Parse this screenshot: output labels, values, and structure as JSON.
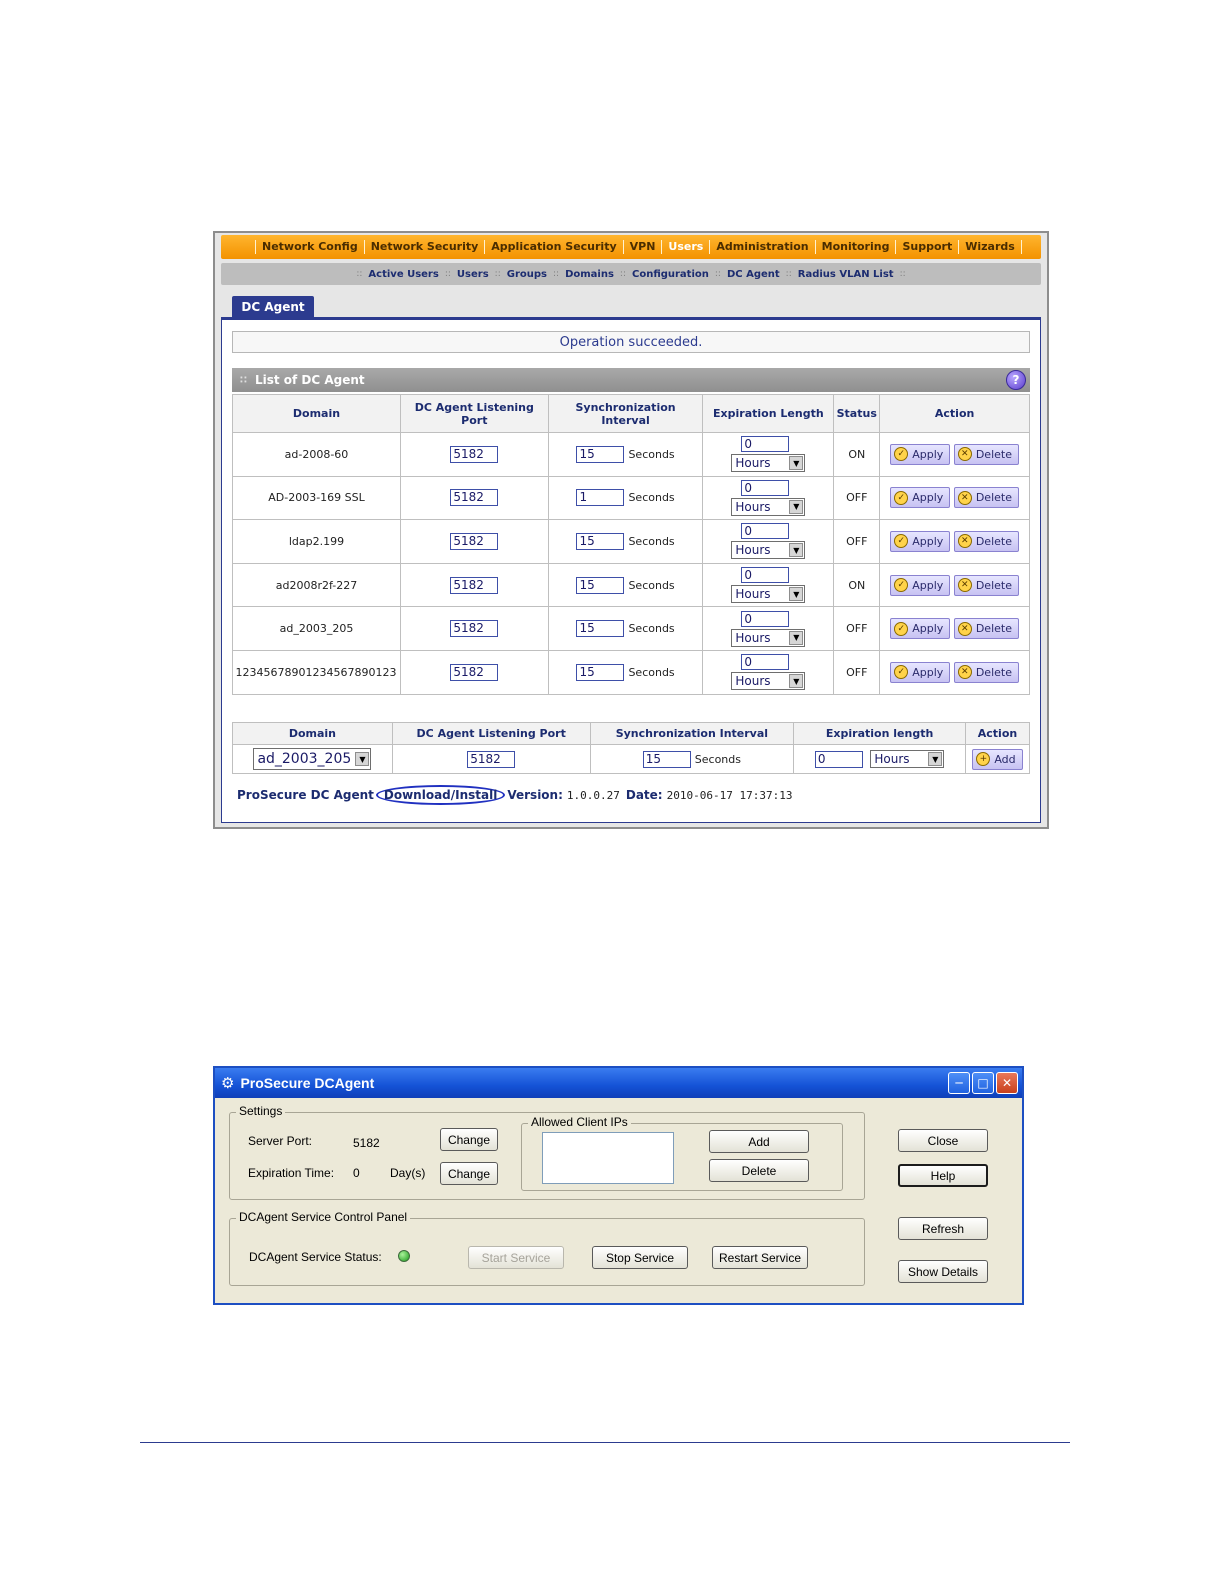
{
  "web": {
    "topnav": [
      "Network Config",
      "Network Security",
      "Application Security",
      "VPN",
      "Users",
      "Administration",
      "Monitoring",
      "Support",
      "Wizards"
    ],
    "topnav_active": "Users",
    "subnav": [
      "Active Users",
      "Users",
      "Groups",
      "Domains",
      "Configuration",
      "DC Agent",
      "Radius VLAN List"
    ],
    "subnav_sep": "::",
    "tab": "DC Agent",
    "message": "Operation succeeded.",
    "list_title": "List of DC Agent",
    "help_glyph": "?",
    "columns": {
      "domain": "Domain",
      "port": "DC Agent Listening Port",
      "sync": "Synchronization Interval",
      "exp": "Expiration Length",
      "status": "Status",
      "action": "Action"
    },
    "seconds_label": "Seconds",
    "apply_label": "Apply",
    "delete_label": "Delete",
    "rows": [
      {
        "domain": "ad-2008-60",
        "port": "5182",
        "sync": "15",
        "exp": "0",
        "unit": "Hours",
        "status": "ON"
      },
      {
        "domain": "AD-2003-169 SSL",
        "port": "5182",
        "sync": "1",
        "exp": "0",
        "unit": "Hours",
        "status": "OFF"
      },
      {
        "domain": "ldap2.199",
        "port": "5182",
        "sync": "15",
        "exp": "0",
        "unit": "Hours",
        "status": "OFF"
      },
      {
        "domain": "ad2008r2f-227",
        "port": "5182",
        "sync": "15",
        "exp": "0",
        "unit": "Hours",
        "status": "ON"
      },
      {
        "domain": "ad_2003_205",
        "port": "5182",
        "sync": "15",
        "exp": "0",
        "unit": "Hours",
        "status": "OFF"
      },
      {
        "domain": "12345678901234567890123",
        "port": "5182",
        "sync": "15",
        "exp": "0",
        "unit": "Hours",
        "status": "OFF"
      }
    ],
    "add": {
      "headers": {
        "domain": "Domain",
        "port": "DC Agent Listening Port",
        "sync": "Synchronization Interval",
        "exp": "Expiration length",
        "action": "Action"
      },
      "domain": "ad_2003_205",
      "port": "5182",
      "sync": "15",
      "exp": "0",
      "unit": "Hours",
      "add_label": "Add"
    },
    "footer": {
      "label": "ProSecure DC Agent",
      "download": "Download/Install",
      "version_label": "Version:",
      "version": "1.0.0.27",
      "date_label": "Date:",
      "date": "2010-06-17 17:37:13"
    }
  },
  "dialog": {
    "title": "ProSecure DCAgent",
    "settings_legend": "Settings",
    "server_port_label": "Server Port:",
    "server_port": "5182",
    "expiration_label": "Expiration Time:",
    "expiration": "0",
    "expiration_unit": "Day(s)",
    "change_label": "Change",
    "allowed_legend": "Allowed Client IPs",
    "add_label": "Add",
    "delete_label": "Delete",
    "close_label": "Close",
    "help_label": "Help",
    "refresh_label": "Refresh",
    "show_details_label": "Show Details",
    "service_legend": "DCAgent Service Control Panel",
    "service_status_label": "DCAgent Service Status:",
    "start_label": "Start Service",
    "stop_label": "Stop Service",
    "restart_label": "Restart Service"
  },
  "colors": {
    "accent_orange": "#f39200",
    "navy": "#2c3b8f",
    "xp_blue": "#1452d6",
    "status_green": "#1a9a19"
  },
  "icons": {
    "apply": "check-circle-icon",
    "delete": "x-circle-icon",
    "add": "plus-circle-icon",
    "help": "question-icon",
    "gear": "gear-icon"
  }
}
